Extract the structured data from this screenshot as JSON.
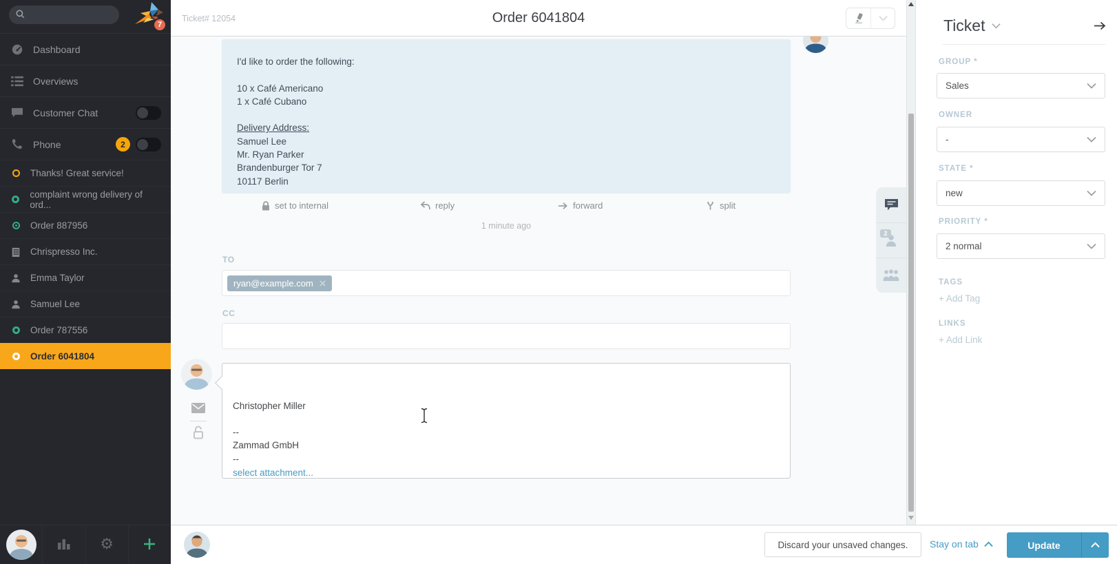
{
  "sidebar": {
    "logo_badge": "7",
    "nav": [
      {
        "label": "Dashboard"
      },
      {
        "label": "Overviews"
      },
      {
        "label": "Customer Chat"
      },
      {
        "label": "Phone",
        "badge": "2"
      }
    ],
    "tickets": [
      {
        "label": "Thanks! Great service!"
      },
      {
        "label": "complaint wrong delivery of ord..."
      },
      {
        "label": "Order 887956"
      },
      {
        "label": "Chrispresso Inc."
      },
      {
        "label": "Emma Taylor"
      },
      {
        "label": "Samuel Lee"
      },
      {
        "label": "Order 787556"
      },
      {
        "label": "Order 6041804"
      }
    ]
  },
  "header": {
    "ticket_ref": "Ticket# 12054",
    "title": "Order 6041804"
  },
  "article": {
    "intro": "I'd like to order the following:",
    "order_lines": [
      "10 x Café Americano",
      "1 x Café Cubano"
    ],
    "address_heading": "Delivery Address:",
    "address_lines": [
      "Samuel Lee",
      "Mr. Ryan Parker",
      "Brandenburger Tor 7",
      "10117 Berlin"
    ],
    "actions": {
      "internal": "set to internal",
      "reply": "reply",
      "forward": "forward",
      "split": "split"
    },
    "timestamp": "1 minute ago"
  },
  "compose": {
    "to_label": "TO",
    "to_recipient": "ryan@example.com",
    "cc_label": "CC",
    "signature": {
      "name": "Christopher Miller",
      "divider": "--",
      "company": "Zammad GmbH"
    },
    "attachment_link": "select attachment..."
  },
  "side_tabs": {
    "customer_badge": "2"
  },
  "ticket_panel": {
    "title": "Ticket",
    "group_label": "GROUP *",
    "group_value": "Sales",
    "owner_label": "OWNER",
    "owner_value": "-",
    "state_label": "STATE *",
    "state_value": "new",
    "priority_label": "PRIORITY *",
    "priority_value": "2 normal",
    "tags_label": "TAGS",
    "add_tag": "+ Add Tag",
    "links_label": "LINKS",
    "add_link": "+ Add Link"
  },
  "footer": {
    "discard": "Discard your unsaved changes.",
    "stay_on_tab": "Stay on tab",
    "update": "Update"
  },
  "colors": {
    "accent_orange": "#f9a71a",
    "accent_blue": "#459cc4",
    "accent_teal": "#35a98a",
    "sidebar_bg": "#25272c"
  }
}
